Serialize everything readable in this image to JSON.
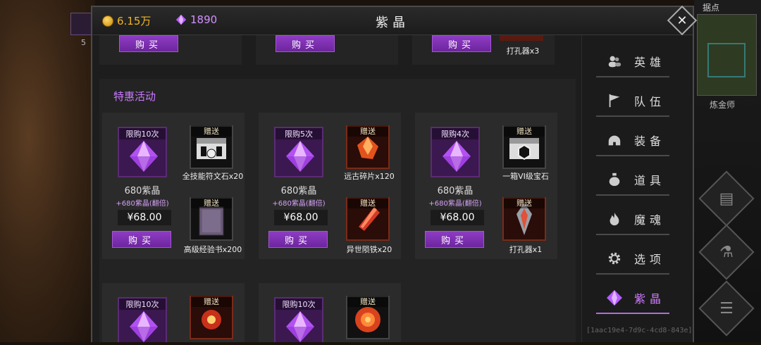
{
  "background": {
    "hero_slot_count": "5",
    "stronghold_label": "据点",
    "alchemist_label": "炼金师"
  },
  "header": {
    "gold": "6.15万",
    "gems": "1890",
    "title": "紫晶",
    "close_icon": "close-icon"
  },
  "top_row": {
    "buy_label": "购买",
    "partial_gift_name": "打孔器x3"
  },
  "section": {
    "title": "特惠活动",
    "buy_label": "购买",
    "gift_tag": "赠送",
    "cards": [
      {
        "limit": "限购10次",
        "amount": "680紫晶",
        "bonus": "+680紫晶(翻倍)",
        "price": "¥68.00",
        "gifts": [
          {
            "name": "全技能符文石x20",
            "icon": "rune-chest-icon"
          },
          {
            "name": "高级经验书x200",
            "icon": "exp-book-icon"
          }
        ]
      },
      {
        "limit": "限购5次",
        "amount": "680紫晶",
        "bonus": "+680紫晶(翻倍)",
        "price": "¥68.00",
        "gifts": [
          {
            "name": "远古碎片x120",
            "icon": "ancient-shard-icon"
          },
          {
            "name": "异世陨铁x20",
            "icon": "meteor-iron-icon"
          }
        ]
      },
      {
        "limit": "限购4次",
        "amount": "680紫晶",
        "bonus": "+680紫晶(翻倍)",
        "price": "¥68.00",
        "gifts": [
          {
            "name": "一箱VI级宝石",
            "icon": "gem-chest-icon"
          },
          {
            "name": "打孔器x1",
            "icon": "drill-icon"
          }
        ]
      },
      {
        "limit": "限购10次",
        "gifts": [
          {
            "icon": "fire-orb-icon"
          }
        ]
      },
      {
        "limit": "限购10次",
        "gifts": [
          {
            "icon": "fire-sphere-icon"
          }
        ]
      }
    ]
  },
  "nav": {
    "items": [
      {
        "label": "英雄",
        "icon": "heroes-icon"
      },
      {
        "label": "队伍",
        "icon": "flag-icon"
      },
      {
        "label": "装备",
        "icon": "helmet-icon"
      },
      {
        "label": "道具",
        "icon": "bag-icon"
      },
      {
        "label": "魔魂",
        "icon": "flame-icon"
      },
      {
        "label": "选项",
        "icon": "gear-icon"
      },
      {
        "label": "紫晶",
        "icon": "amethyst-icon"
      }
    ],
    "active": "紫晶",
    "footer_id": "[1aac19e4-7d9c-4cd8-843e]"
  },
  "colors": {
    "accent": "#c978ff",
    "buy_button": "#7e30b2",
    "gold": "#f0b428"
  }
}
